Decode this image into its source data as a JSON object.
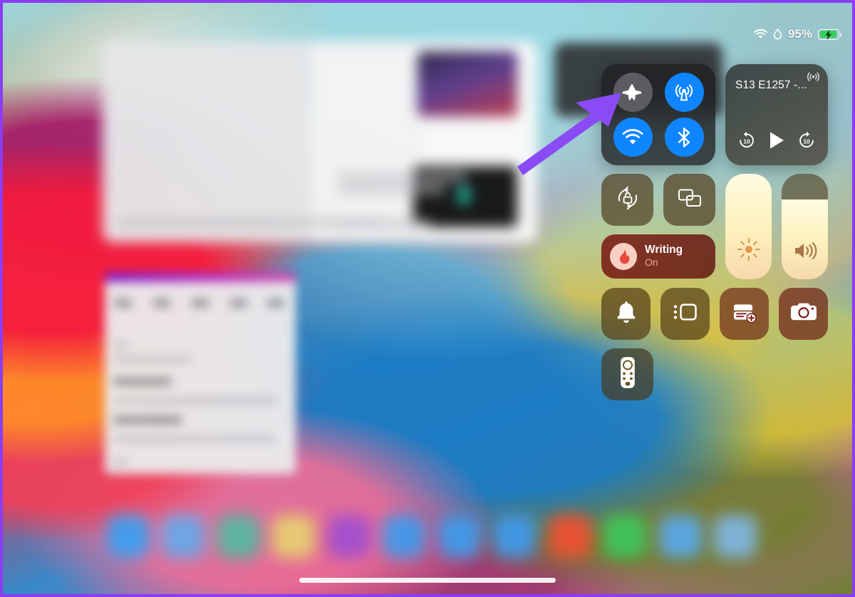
{
  "device": {
    "platform": "iPadOS",
    "frame_color": "#8a3df2"
  },
  "status_bar": {
    "wifi_icon": "wifi-icon",
    "humidity_icon": "water-drop-icon",
    "battery_percent": "95%",
    "battery_icon": "battery-charging-icon",
    "battery_color": "#31d158"
  },
  "control_center": {
    "connectivity": {
      "toggles": [
        {
          "name": "airplane-mode",
          "icon": "airplane-icon",
          "state": "off",
          "color": "#5c5c60"
        },
        {
          "name": "cellular-data",
          "icon": "cellular-antenna-icon",
          "state": "on",
          "color": "#0f86ff"
        },
        {
          "name": "wifi",
          "icon": "wifi-icon",
          "state": "on",
          "color": "#0f86ff"
        },
        {
          "name": "bluetooth",
          "icon": "bluetooth-icon",
          "state": "on",
          "color": "#0f86ff"
        }
      ]
    },
    "media": {
      "title": "S13 E1257 -...",
      "airplay_icon": "airplay-audio-icon",
      "controls": [
        {
          "name": "skip-back-10",
          "label": "10"
        },
        {
          "name": "play",
          "label": ""
        },
        {
          "name": "skip-forward-10",
          "label": "10"
        }
      ]
    },
    "quick_tiles_row1": [
      {
        "name": "rotation-lock",
        "icon": "rotation-lock-icon"
      },
      {
        "name": "screen-mirroring",
        "icon": "screen-mirroring-icon"
      }
    ],
    "focus": {
      "name": "Writing",
      "state": "On",
      "icon": "flame-icon",
      "icon_bg": "#f9cfc4",
      "state_color": "#f0a2a0"
    },
    "brightness": {
      "name": "brightness-slider",
      "icon": "sun-icon",
      "level_percent": 100
    },
    "volume": {
      "name": "volume-slider",
      "icon": "speaker-waves-icon",
      "level_percent": 76
    },
    "quick_tiles_row2": [
      {
        "name": "silent-mode",
        "icon": "bell-icon"
      },
      {
        "name": "stage-manager",
        "icon": "stage-manager-icon"
      },
      {
        "name": "new-note",
        "icon": "new-note-icon"
      },
      {
        "name": "camera",
        "icon": "camera-icon"
      }
    ],
    "quick_tiles_row3": [
      {
        "name": "apple-tv-remote",
        "icon": "remote-icon"
      }
    ]
  },
  "annotation": {
    "arrow_color": "#8a4bf5",
    "points_at": "airplane-mode-toggle"
  },
  "dock": {
    "app_count": 12,
    "app_colors": [
      "#3b9ff0",
      "#69a8e8",
      "#56b7a0",
      "#e6cf72",
      "#a24fd0",
      "#3f9aea",
      "#3f9aea",
      "#3f9aea",
      "#ef5134",
      "#3ec65b",
      "#5aa9e8",
      "#7fb5e0"
    ]
  },
  "home_indicator": {
    "name": "home-indicator"
  }
}
